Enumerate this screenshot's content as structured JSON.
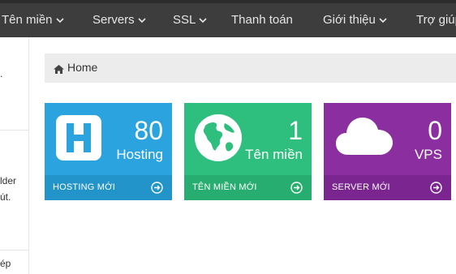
{
  "nav": {
    "items": [
      {
        "label": "Tên miền",
        "dropdown": true
      },
      {
        "label": "Servers",
        "dropdown": true
      },
      {
        "label": "SSL",
        "dropdown": true
      },
      {
        "label": "Thanh toán",
        "dropdown": false
      },
      {
        "label": "Giới thiệu",
        "dropdown": true
      },
      {
        "label": "Trợ giúp",
        "dropdown": false
      }
    ]
  },
  "sidebar": {
    "line1": "lder",
    "line2": "út.",
    "line3": "ép"
  },
  "breadcrumb": {
    "icon": "home-icon",
    "label": "Home"
  },
  "tiles": [
    {
      "count": "80",
      "label": "Hosting",
      "footer": "HOSTING MỚI",
      "icon": "hosting-h-icon",
      "color": "#2aa3df",
      "footer_color": "#2294c9"
    },
    {
      "count": "1",
      "label": "Tên miền",
      "footer": "TÊN MIỀN MỚI",
      "icon": "globe-icon",
      "color": "#2ebf7e",
      "footer_color": "#27ad70"
    },
    {
      "count": "0",
      "label": "VPS",
      "footer": "SERVER MỚI",
      "icon": "cloud-icon",
      "color": "#8b2e9f",
      "footer_color": "#7a2590"
    }
  ],
  "colors": {
    "topbar": "#3d3d3d",
    "breadcrumb_bg": "#ececec"
  }
}
